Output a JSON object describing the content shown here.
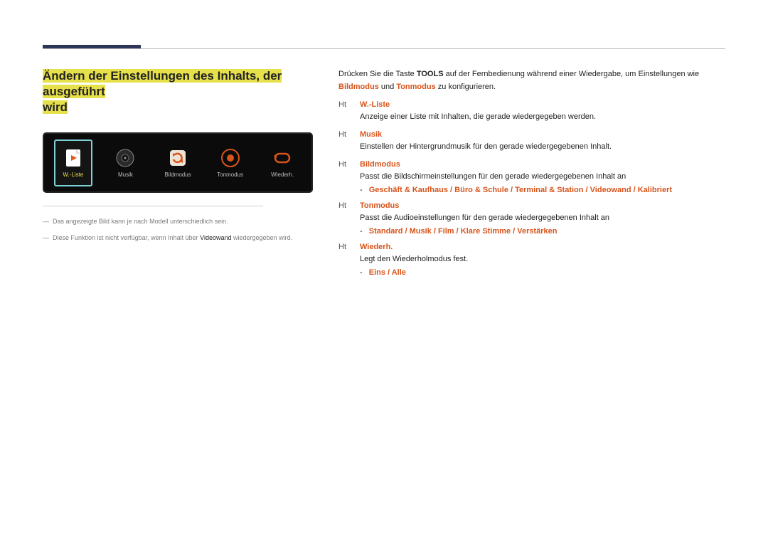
{
  "title_l1": "Ändern der Einstellungen des Inhalts, der ausgeführt",
  "title_l2": "wird",
  "device": {
    "items": [
      {
        "label": "W.-Liste"
      },
      {
        "label": "Musik"
      },
      {
        "label": "Bildmodus"
      },
      {
        "label": "Tonmodus"
      },
      {
        "label": "Wiederh."
      }
    ]
  },
  "footnotes": {
    "n1_dash": "―",
    "n1": "Das angezeigte Bild kann je nach Modell unterschiedlich sein.",
    "n2_dash": "―",
    "n2_a": "Diese Funktion ist nicht verfügbar, wenn Inhalt über ",
    "n2_b": "Videowand",
    "n2_c": " wiedergegeben wird."
  },
  "intro": {
    "p1_a": "Drücken Sie die Taste ",
    "p1_b": "TOOLS",
    "p1_c": " auf der Fernbedienung während einer Wiedergabe, um Einstellungen wie ",
    "p1_d": "Bildmodus",
    "p1_e": " und ",
    "p1_f": "Tonmodus",
    "p1_g": " zu konfigurieren."
  },
  "items": {
    "ht": "Ht",
    "dash": "-",
    "wliste": {
      "title": "W.-Liste",
      "desc": "Anzeige einer Liste mit Inhalten, die gerade wiedergegeben werden."
    },
    "musik": {
      "title": "Musik",
      "desc": "Einstellen der Hintergrundmusik für den gerade wiedergegebenen Inhalt."
    },
    "bild": {
      "title": "Bildmodus",
      "desc": "Passt die Bildschirmeinstellungen für den gerade wiedergegebenen Inhalt an",
      "opts": [
        "Geschäft & Kaufhaus",
        "Büro & Schule",
        "Terminal & Station",
        "Videowand",
        "Kalibriert"
      ],
      "sep": " / "
    },
    "ton": {
      "title": "Tonmodus",
      "desc": "Passt die Audioeinstellungen für den gerade wiedergegebenen Inhalt an",
      "opts": [
        "Standard",
        "Musik",
        "Film",
        "Klare Stimme",
        "Verstärken"
      ],
      "sep": " / "
    },
    "wied": {
      "title": "Wiederh.",
      "desc": "Legt den Wiederholmodus fest.",
      "opts": [
        "Eins",
        "Alle"
      ],
      "sep": " / "
    }
  }
}
